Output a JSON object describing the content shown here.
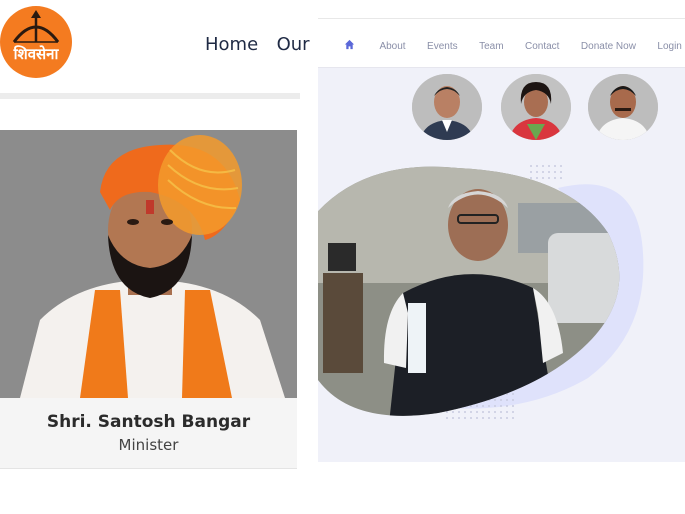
{
  "left_site": {
    "logo": {
      "text": "शिवसेना",
      "color": "#f47b20"
    },
    "nav": {
      "items": [
        "Home",
        "Our"
      ]
    },
    "profile": {
      "name": "Shri. Santosh Bangar",
      "role": "Minister"
    }
  },
  "right_site": {
    "nav": {
      "home_icon": "home-icon",
      "items": [
        "About",
        "Events",
        "Team",
        "Contact",
        "Donate Now",
        "Login"
      ],
      "accent": "#5a67d8"
    },
    "team_avatars": 3,
    "blob_color": "#dfe2fb"
  }
}
